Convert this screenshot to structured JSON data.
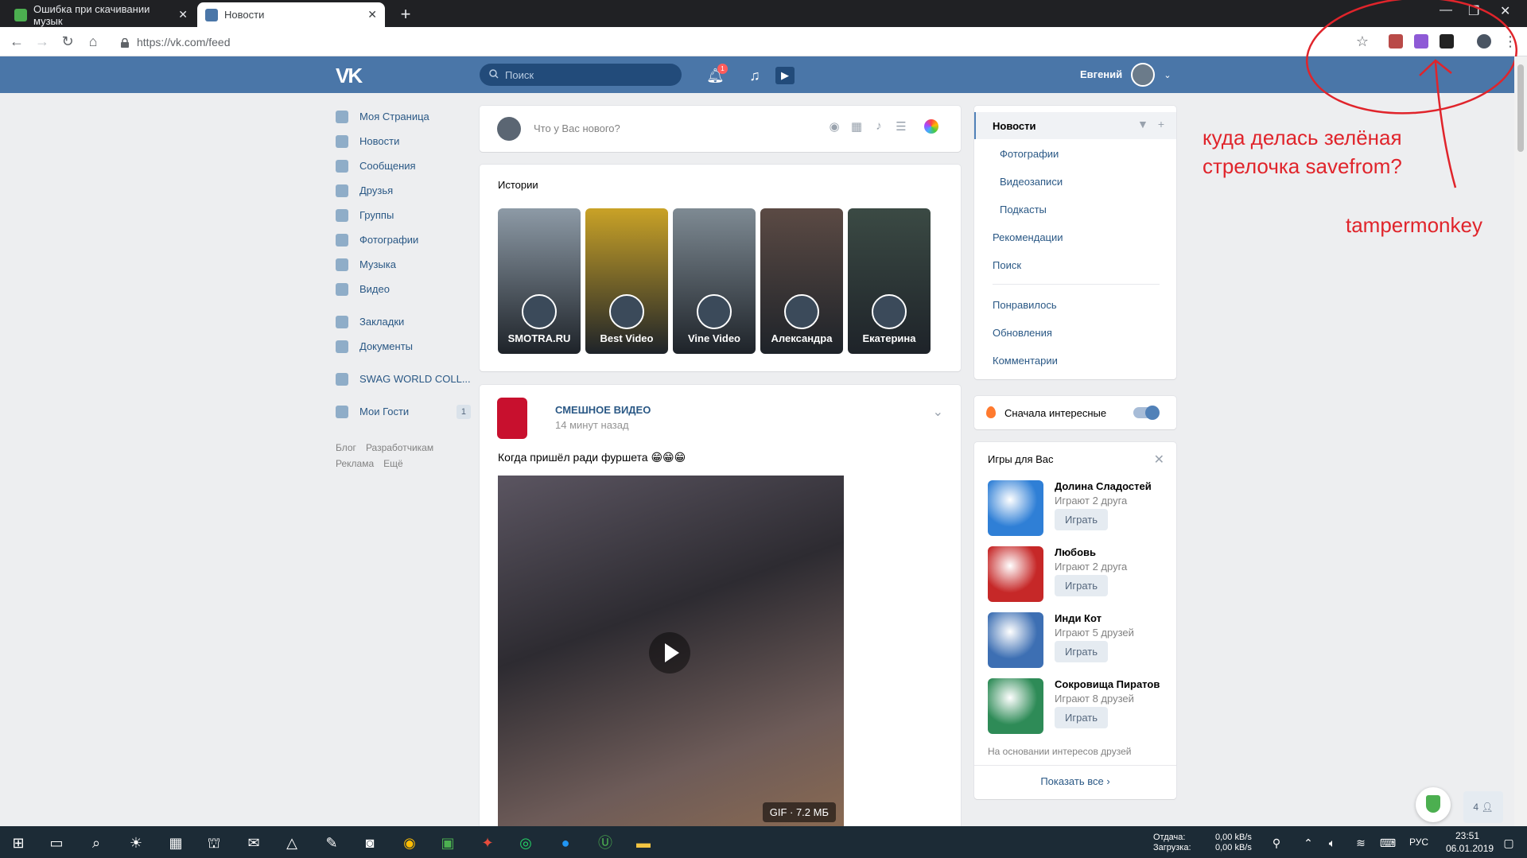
{
  "browser": {
    "tabs": [
      {
        "title": "Ошибка при скачивании музык",
        "active": false
      },
      {
        "title": "Новости",
        "active": true
      }
    ],
    "url": "https://vk.com/feed"
  },
  "header": {
    "search_placeholder": "Поиск",
    "notifications_count": "1",
    "user_name": "Евгений"
  },
  "left_menu": [
    {
      "label": "Моя Страница",
      "icon": "home-icon"
    },
    {
      "label": "Новости",
      "icon": "news-icon"
    },
    {
      "label": "Сообщения",
      "icon": "messages-icon"
    },
    {
      "label": "Друзья",
      "icon": "friends-icon"
    },
    {
      "label": "Группы",
      "icon": "groups-icon"
    },
    {
      "label": "Фотографии",
      "icon": "photos-icon"
    },
    {
      "label": "Музыка",
      "icon": "music-icon"
    },
    {
      "label": "Видео",
      "icon": "video-icon"
    },
    {
      "label": "Закладки",
      "icon": "bookmarks-icon"
    },
    {
      "label": "Документы",
      "icon": "documents-icon"
    },
    {
      "label": "SWAG WORLD COLL...",
      "icon": "group-icon"
    },
    {
      "label": "Мои Гости",
      "icon": "app-icon",
      "count": "1"
    }
  ],
  "left_footer": {
    "blog": "Блог",
    "developers": "Разработчикам",
    "ads": "Реклама",
    "more": "Ещё"
  },
  "composer": {
    "placeholder": "Что у Вас нового?"
  },
  "stories": {
    "title": "Истории",
    "items": [
      {
        "name": "SMOTRA.RU",
        "color": "#8d9aa6"
      },
      {
        "name": "Best Video",
        "color": "#c9a227"
      },
      {
        "name": "Vine Video",
        "color": "#7e8a93"
      },
      {
        "name": "Александра",
        "color": "#5b4a44"
      },
      {
        "name": "Екатерина",
        "color": "#3b4a44"
      }
    ]
  },
  "post": {
    "group_name": "СМЕШНОЕ ВИДЕО",
    "time": "14 минут назад",
    "text": "Когда пришёл ради фуршета 😁😁😁",
    "media_label": "GIF · 7.2 МБ"
  },
  "right_menu": {
    "items": [
      {
        "label": "Новости",
        "type": "active"
      },
      {
        "label": "Фотографии",
        "type": "sub"
      },
      {
        "label": "Видеозаписи",
        "type": "sub"
      },
      {
        "label": "Подкасты",
        "type": "sub"
      },
      {
        "label": "Рекомендации",
        "type": "main"
      },
      {
        "label": "Поиск",
        "type": "main"
      },
      {
        "label": "Понравилось",
        "type": "main"
      },
      {
        "label": "Обновления",
        "type": "main"
      },
      {
        "label": "Комментарии",
        "type": "main"
      }
    ]
  },
  "interest": {
    "label": "Сначала интересные",
    "enabled": true
  },
  "games": {
    "title": "Игры для Вас",
    "items": [
      {
        "name": "Долина Сладостей",
        "players": "Играют 2 друга",
        "button": "Играть",
        "color": "#2f7fd6"
      },
      {
        "name": "Любовь",
        "players": "Играют 2 друга",
        "button": "Играть",
        "color": "#c62828"
      },
      {
        "name": "Инди Кот",
        "players": "Играют 5 друзей",
        "button": "Играть",
        "color": "#3d6fb3"
      },
      {
        "name": "Сокровища Пиратов",
        "players": "Играют 8 друзей",
        "button": "Играть",
        "color": "#2e8b57"
      }
    ],
    "footer": "На основании интересов друзей",
    "show_all": "Показать все"
  },
  "annotation": {
    "line1": "куда делась зелёная",
    "line2": "стрелочка savefrom?",
    "line3": "tampermonkey"
  },
  "friends_online": "4",
  "taskbar": {
    "upload_label": "Отдача:",
    "download_label": "Загрузка:",
    "upload_speed": "0,00 kB/s",
    "download_speed": "0,00 kB/s",
    "language": "РУС",
    "time": "23:51",
    "date": "06.01.2019"
  }
}
